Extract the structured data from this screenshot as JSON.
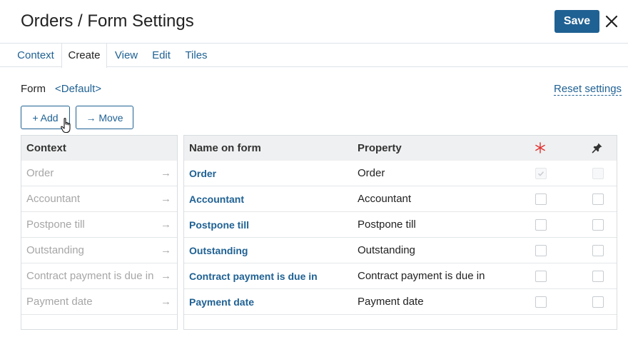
{
  "header": {
    "title": "Orders / Form Settings",
    "save_label": "Save",
    "close_icon": "close-icon"
  },
  "tabs": [
    {
      "label": "Context",
      "active": false
    },
    {
      "label": "Create",
      "active": true
    },
    {
      "label": "View",
      "active": false
    },
    {
      "label": "Edit",
      "active": false
    },
    {
      "label": "Tiles",
      "active": false
    }
  ],
  "form": {
    "label": "Form",
    "value": "<Default>",
    "reset_label": "Reset settings"
  },
  "toolbar": {
    "add_label": "+ Add",
    "move_label": "→ Move"
  },
  "context_panel": {
    "header": "Context",
    "items": [
      {
        "label": "Order",
        "arrow": "→"
      },
      {
        "label": "Accountant",
        "arrow": "→"
      },
      {
        "label": "Postpone till",
        "arrow": "→"
      },
      {
        "label": "Outstanding",
        "arrow": "→"
      },
      {
        "label": "Contract payment is due in",
        "arrow": "→"
      },
      {
        "label": "Payment date",
        "arrow": "→"
      }
    ]
  },
  "fields_table": {
    "columns": {
      "name": "Name on form",
      "property": "Property",
      "required_icon": "asterisk-icon",
      "pin_icon": "pin-icon"
    },
    "rows": [
      {
        "name": "Order",
        "property": "Order",
        "required": true,
        "required_disabled": true,
        "pinned": false,
        "pin_disabled": true
      },
      {
        "name": "Accountant",
        "property": "Accountant",
        "required": false,
        "required_disabled": false,
        "pinned": false,
        "pin_disabled": false
      },
      {
        "name": "Postpone till",
        "property": "Postpone till",
        "required": false,
        "required_disabled": false,
        "pinned": false,
        "pin_disabled": false
      },
      {
        "name": "Outstanding",
        "property": "Outstanding",
        "required": false,
        "required_disabled": false,
        "pinned": false,
        "pin_disabled": false
      },
      {
        "name": "Contract payment is due in",
        "property": "Contract payment is due in",
        "required": false,
        "required_disabled": false,
        "pinned": false,
        "pin_disabled": false
      },
      {
        "name": "Payment date",
        "property": "Payment date",
        "required": false,
        "required_disabled": false,
        "pinned": false,
        "pin_disabled": false
      }
    ]
  },
  "colors": {
    "accent": "#1f6193",
    "required_icon": "#e0302e",
    "muted_text": "#a6a6a6"
  }
}
